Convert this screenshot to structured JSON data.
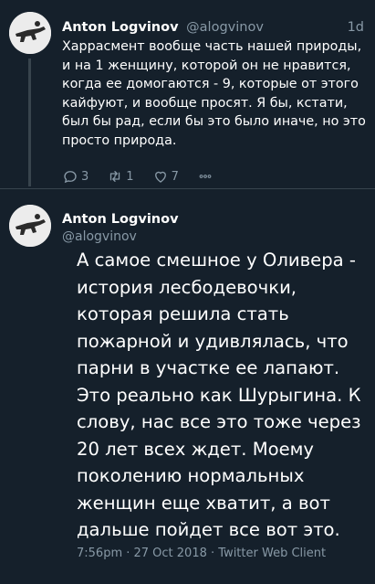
{
  "tweet1": {
    "author_name": "Anton Logvinov",
    "author_handle": "@alogvinov",
    "time": "1d",
    "text": "Харрасмент вообще часть нашей природы, и на 1 женщину, которой он не нравится, когда ее домогаются - 9, которые от этого кайфуют, и вообще просят. Я бы, кстати, был бы рад, если бы это было иначе, но это просто природа.",
    "replies": "3",
    "retweets": "1",
    "likes": "7"
  },
  "tweet2": {
    "author_name": "Anton Logvinov",
    "author_handle": "@alogvinov",
    "text": "А самое смешное у Оливера - история лесбодевочки, которая решила стать пожарной и удивлялась, что парни в участке ее лапают. Это реально как Шурыгина. К слову, нас все это тоже через 20 лет всех ждет. Моему поколению нормальных женщин еще хватит, а вот дальше пойдет все вот это.",
    "meta": "7:56pm · 27 Oct 2018 · Twitter Web Client"
  },
  "colors": {
    "background": "#15202b",
    "text": "#ffffff",
    "secondary": "#8899a6",
    "divider": "#38444d"
  },
  "icons": [
    "reply-icon",
    "retweet-icon",
    "like-icon",
    "more-icon"
  ]
}
